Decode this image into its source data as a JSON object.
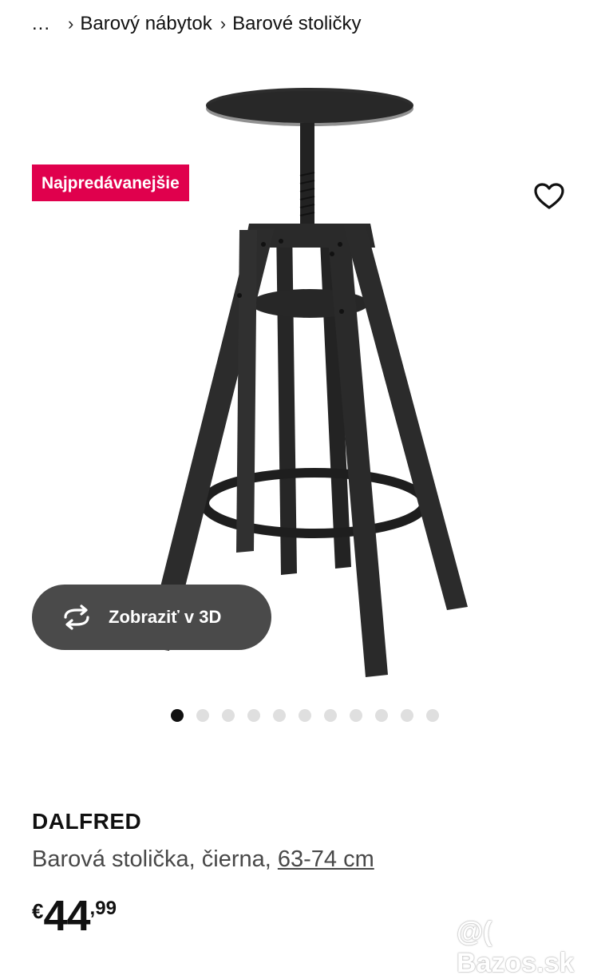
{
  "breadcrumb": {
    "ellipsis": "...",
    "items": [
      "Barový nábytok",
      "Barové stoličky"
    ]
  },
  "product_image": {
    "icon_name": "bar-stool-image",
    "badge": "Najpredávanejšie",
    "favorite_icon": "heart-outline-icon",
    "view3d_label": "Zobraziť v 3D",
    "view3d_icon": "rotate-3d-icon"
  },
  "carousel": {
    "total": 11,
    "active_index": 0
  },
  "product": {
    "name": "DALFRED",
    "description": "Barová stolička, čierna, ",
    "size_link": "63-74 cm"
  },
  "price": {
    "currency": "€",
    "integer": "44",
    "decimals": ",99"
  },
  "watermark": "@( Bazos.sk",
  "colors": {
    "badge": "#e0004d",
    "button_bg": "#4a4a4a",
    "stool": "#2b2b2b"
  }
}
